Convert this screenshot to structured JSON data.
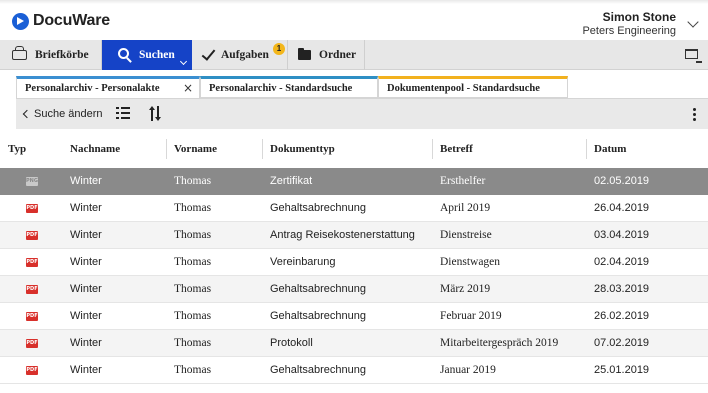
{
  "app": {
    "logo_text": "DocuWare",
    "user_name": "Simon Stone",
    "user_org": "Peters Engineering"
  },
  "nav": {
    "briefkoerbe": "Briefkörbe",
    "suchen": "Suchen",
    "aufgaben": "Aufgaben",
    "aufgaben_badge": "1",
    "ordner": "Ordner"
  },
  "tabs": [
    {
      "label": "Personalarchiv - Personalakte",
      "close": "×",
      "accent": "#3b8fd1"
    },
    {
      "label": "Personalarchiv - Standardsuche",
      "accent": "#2f8fc4"
    },
    {
      "label": "Dokumentenpool - Standardsuche",
      "accent": "#f2b11e"
    }
  ],
  "toolbar": {
    "back_label": "Suche ändern"
  },
  "table": {
    "headers": [
      "Typ",
      "Nachname",
      "Vorname",
      "Dokumenttyp",
      "Betreff",
      "Datum"
    ],
    "rows": [
      {
        "type": "PNG",
        "nachname": "Winter",
        "vorname": "Thomas",
        "dokumenttyp": "Zertifikat",
        "betreff": "Ersthelfer",
        "datum": "02.05.2019"
      },
      {
        "type": "PDF",
        "nachname": "Winter",
        "vorname": "Thomas",
        "dokumenttyp": "Gehaltsabrechnung",
        "betreff": "April 2019",
        "datum": "26.04.2019"
      },
      {
        "type": "PDF",
        "nachname": "Winter",
        "vorname": "Thomas",
        "dokumenttyp": "Antrag Reisekostenerstattung",
        "betreff": "Dienstreise",
        "datum": "03.04.2019"
      },
      {
        "type": "PDF",
        "nachname": "Winter",
        "vorname": "Thomas",
        "dokumenttyp": "Vereinbarung",
        "betreff": "Dienstwagen",
        "datum": "02.04.2019"
      },
      {
        "type": "PDF",
        "nachname": "Winter",
        "vorname": "Thomas",
        "dokumenttyp": "Gehaltsabrechnung",
        "betreff": "März 2019",
        "datum": "28.03.2019"
      },
      {
        "type": "PDF",
        "nachname": "Winter",
        "vorname": "Thomas",
        "dokumenttyp": "Gehaltsabrechnung",
        "betreff": "Februar 2019",
        "datum": "26.02.2019"
      },
      {
        "type": "PDF",
        "nachname": "Winter",
        "vorname": "Thomas",
        "dokumenttyp": "Protokoll",
        "betreff": "Mitarbeitergespräch 2019",
        "datum": "07.02.2019"
      },
      {
        "type": "PDF",
        "nachname": "Winter",
        "vorname": "Thomas",
        "dokumenttyp": "Gehaltsabrechnung",
        "betreff": "Januar 2019",
        "datum": "25.01.2019"
      }
    ]
  },
  "colors": {
    "accent_blue": "#1543c7",
    "selected_row": "#8a8a8a",
    "pdf_red": "#d8302b",
    "badge_yellow": "#f3b61a"
  }
}
